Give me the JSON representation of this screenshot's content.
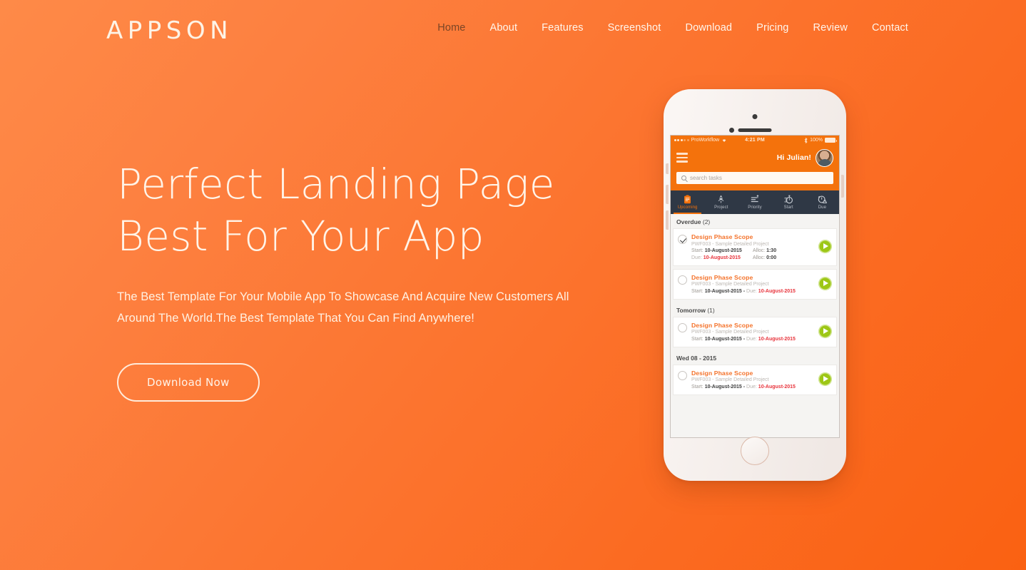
{
  "brand": {
    "logo": "APPSON"
  },
  "nav": {
    "items": [
      {
        "label": "Home",
        "active": true
      },
      {
        "label": "About",
        "active": false
      },
      {
        "label": "Features",
        "active": false
      },
      {
        "label": "Screenshot",
        "active": false
      },
      {
        "label": "Download",
        "active": false
      },
      {
        "label": "Pricing",
        "active": false
      },
      {
        "label": "Review",
        "active": false
      },
      {
        "label": "Contact",
        "active": false
      }
    ]
  },
  "hero": {
    "title_line1": "Perfect Landing Page",
    "title_line2": "Best For Your App",
    "subtitle": "The Best Template For Your Mobile App To Showcase And Acquire New Customers All Around The World.The Best Template That You Can Find Anywhere!",
    "cta_label": "Download Now"
  },
  "colors": {
    "bg_top_left": "#FE8A48",
    "bg_bottom_right": "#FA6112",
    "text_cream": "#FFF4E8",
    "nav_active": "#7A4526",
    "app_orange": "#F4720C",
    "tabbar_dark": "#2F3845",
    "play_green": "#9DC715",
    "due_red": "#E8333B",
    "task_title_orange": "#F4722A"
  },
  "phone": {
    "statusbar": {
      "carrier": "ProWorkflow",
      "wifi_icon": "wifi-icon",
      "time": "4:21 PM",
      "bluetooth_icon": "bluetooth-icon",
      "battery_percent": "100%"
    },
    "app": {
      "menu_icon": "hamburger-menu-icon",
      "greeting": "Hi Julian!",
      "avatar_icon": "user-avatar",
      "search_placeholder": "search tasks",
      "search_icon": "search-icon",
      "tabs": [
        {
          "label": "Upcoming",
          "icon": "clipboard-icon",
          "active": true
        },
        {
          "label": "Project",
          "icon": "rocket-icon",
          "active": false
        },
        {
          "label": "Priority",
          "icon": "priority-list-icon",
          "active": false
        },
        {
          "label": "Start",
          "icon": "stopwatch-icon",
          "active": false
        },
        {
          "label": "Due",
          "icon": "alarm-warning-icon",
          "active": false
        }
      ],
      "sections": [
        {
          "title": "Overdue",
          "count": "(2)",
          "tasks": [
            {
              "checked": true,
              "title": "Design Phase Scope",
              "project": "PWF003 - Sample Detailed Project",
              "layout": "two-line",
              "start_label": "Start:",
              "start_value": "10-August-2015",
              "alloc1_label": "Alloc:",
              "alloc1_value": "1:30",
              "due_label": "Due:",
              "due_value": "10-August-2015",
              "alloc2_label": "Alloc:",
              "alloc2_value": "0:00",
              "action_icon": "play-icon"
            },
            {
              "checked": false,
              "title": "Design Phase Scope",
              "project": "PWF003 - Sample Detailed Project",
              "layout": "one-line",
              "start_label": "Start:",
              "start_value": "10-August-2015 -",
              "due_label": "Due:",
              "due_value": "10-August-2015",
              "action_icon": "play-icon"
            }
          ]
        },
        {
          "title": "Tomorrow",
          "count": "(1)",
          "tasks": [
            {
              "checked": false,
              "title": "Design Phase Scope",
              "project": "PWF003 - Sample Detailed Project",
              "layout": "one-line",
              "start_label": "Start:",
              "start_value": "10-August-2015 -",
              "due_label": "Due:",
              "due_value": "10-August-2015",
              "action_icon": "play-icon"
            }
          ]
        },
        {
          "title": "Wed 08 - 2015",
          "count": "",
          "tasks": [
            {
              "checked": false,
              "title": "Design Phase Scope",
              "project": "PWF003 - Sample Detailed Project",
              "layout": "one-line",
              "start_label": "Start:",
              "start_value": "10-August-2015 -",
              "due_label": "Due:",
              "due_value": "10-August-2015",
              "action_icon": "play-icon"
            }
          ]
        }
      ]
    }
  }
}
